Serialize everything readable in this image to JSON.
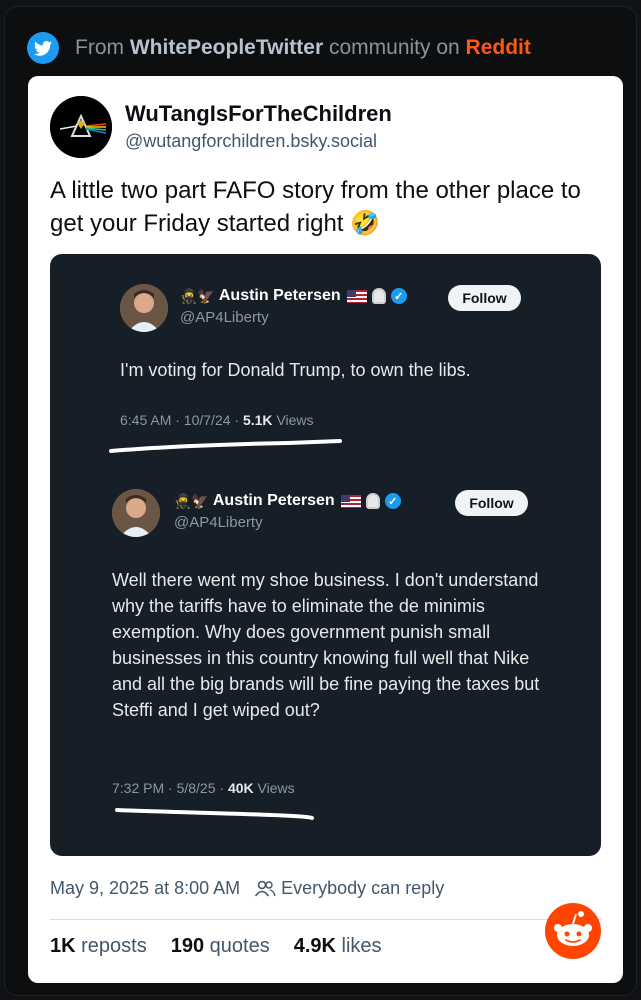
{
  "source": {
    "prefix": "From",
    "community": "WhitePeopleTwitter",
    "middle": "community on",
    "platform": "Reddit"
  },
  "post": {
    "author_name": "WuTangIsForTheChildren",
    "author_handle": "@wutangforchildren.bsky.social",
    "text": "A little two part FAFO story from the other place to get your Friday started right 🤣",
    "date": "May 9, 2025 at 8:00 AM",
    "reply_setting": "Everybody can reply",
    "stats": {
      "reposts_count": "1K",
      "reposts_label": "reposts",
      "quotes_count": "190",
      "quotes_label": "quotes",
      "likes_count": "4.9K",
      "likes_label": "likes"
    }
  },
  "embedded_tweets": [
    {
      "emojis": "🥷🦅",
      "name": "Austin Petersen",
      "handle": "@AP4Liberty",
      "follow_label": "Follow",
      "text": "I'm voting for Donald Trump, to own the libs.",
      "meta_prefix": "6:45 AM · 10/7/24 · ",
      "views_count": "5.1K",
      "views_label": "Views"
    },
    {
      "emojis": "🥷🦅",
      "name": "Austin Petersen",
      "handle": "@AP4Liberty",
      "follow_label": "Follow",
      "text": "Well there went my shoe business. I don't understand why the tariffs have to eliminate the de minimis exemption. Why does government punish small businesses in this country knowing full well that Nike and all the big brands will be fine paying the taxes but Steffi and I get wiped out?",
      "meta_prefix": "7:32 PM · 5/8/25 · ",
      "views_count": "40K",
      "views_label": "Views"
    }
  ],
  "colors": {
    "reddit_orange": "#ff4500",
    "twitter_blue": "#1d9bf0",
    "embed_bg": "#161e27"
  }
}
